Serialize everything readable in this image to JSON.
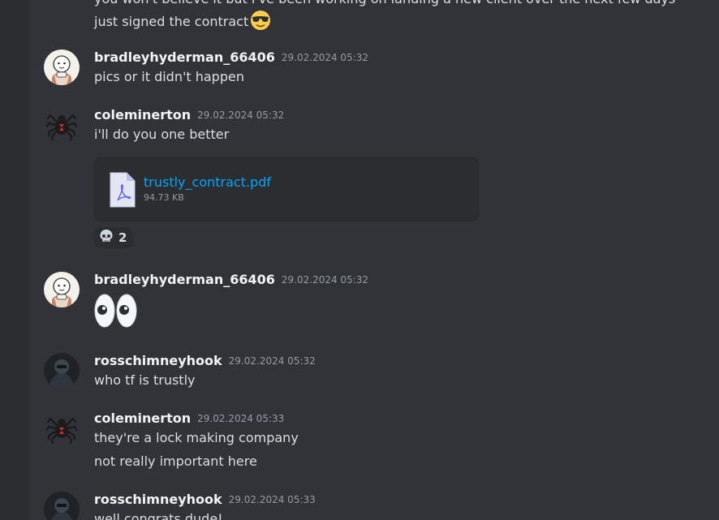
{
  "messages": {
    "m0": {
      "text_truncated": "you won't believe it but i've been working on landing a new client over the next few days",
      "text": "just signed the contract",
      "emoji": "sunglasses-face"
    },
    "m1": {
      "username": "bradleyhyderman_66406",
      "timestamp": "29.02.2024 05:32",
      "text": "pics or it didn't happen"
    },
    "m2": {
      "username": "coleminerton",
      "timestamp": "29.02.2024 05:32",
      "text": "i'll do you one better",
      "attachment": {
        "name": "trustly_contract.pdf",
        "size": "94.73 KB",
        "icon": "pdf-file-icon"
      },
      "reaction": {
        "emoji": "skull",
        "count": "2"
      }
    },
    "m3": {
      "username": "bradleyhyderman_66406",
      "timestamp": "29.02.2024 05:32",
      "emoji": "eyes"
    },
    "m4": {
      "username": "rosschimneyhook",
      "timestamp": "29.02.2024 05:32",
      "text": "who tf is trustly"
    },
    "m5": {
      "username": "coleminerton",
      "timestamp": "29.02.2024 05:33",
      "text": "they're a lock making company",
      "text2": "not really important here"
    },
    "m6": {
      "username": "rosschimneyhook",
      "timestamp": "29.02.2024 05:33",
      "text": "well congrats dude!"
    }
  },
  "colors": {
    "background": "#313338",
    "username": "#f2f3f5",
    "timestamp": "#949ba4",
    "message_text": "#dbdee1",
    "link": "#00a8fc"
  }
}
